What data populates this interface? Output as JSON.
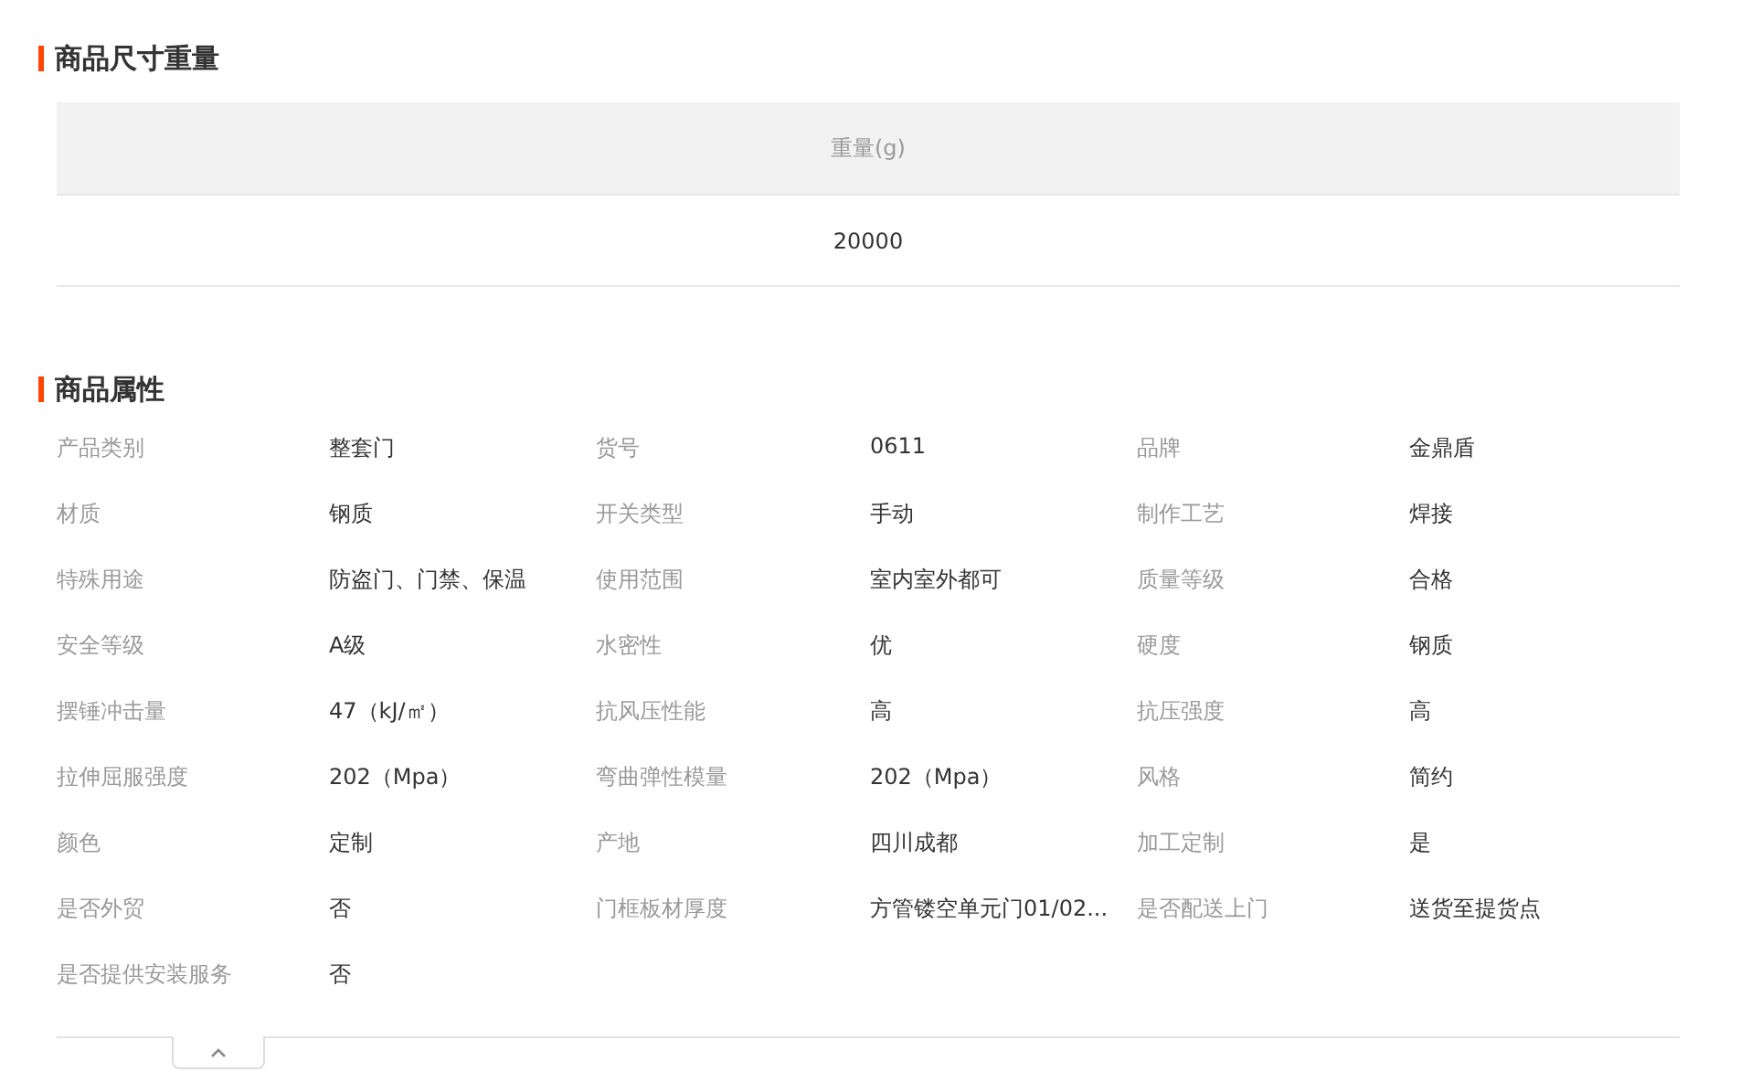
{
  "size_section": {
    "title": "商品尺寸重量",
    "columns": [
      "重量(g)"
    ],
    "rows": [
      [
        "20000"
      ]
    ]
  },
  "attributes_section": {
    "title": "商品属性",
    "attributes": [
      {
        "label": "产品类别",
        "value": "整套门"
      },
      {
        "label": "货号",
        "value": "0611"
      },
      {
        "label": "品牌",
        "value": "金鼎盾"
      },
      {
        "label": "材质",
        "value": "钢质"
      },
      {
        "label": "开关类型",
        "value": "手动"
      },
      {
        "label": "制作工艺",
        "value": "焊接"
      },
      {
        "label": "特殊用途",
        "value": "防盗门、门禁、保温"
      },
      {
        "label": "使用范围",
        "value": "室内室外都可"
      },
      {
        "label": "质量等级",
        "value": "合格"
      },
      {
        "label": "安全等级",
        "value": "A级"
      },
      {
        "label": "水密性",
        "value": "优"
      },
      {
        "label": "硬度",
        "value": "钢质"
      },
      {
        "label": "摆锤冲击量",
        "value": "47（kJ/㎡）"
      },
      {
        "label": "抗风压性能",
        "value": "高"
      },
      {
        "label": "抗压强度",
        "value": "高"
      },
      {
        "label": "拉伸屈服强度",
        "value": "202（Mpa）"
      },
      {
        "label": "弯曲弹性模量",
        "value": "202（Mpa）"
      },
      {
        "label": "风格",
        "value": "简约"
      },
      {
        "label": "颜色",
        "value": "定制"
      },
      {
        "label": "产地",
        "value": "四川成都"
      },
      {
        "label": "加工定制",
        "value": "是"
      },
      {
        "label": "是否外贸",
        "value": "否"
      },
      {
        "label": "门框板材厚度",
        "value": "方管镂空单元门01/02..."
      },
      {
        "label": "是否配送上门",
        "value": "送货至提货点"
      },
      {
        "label": "是否提供安装服务",
        "value": "否"
      }
    ]
  }
}
